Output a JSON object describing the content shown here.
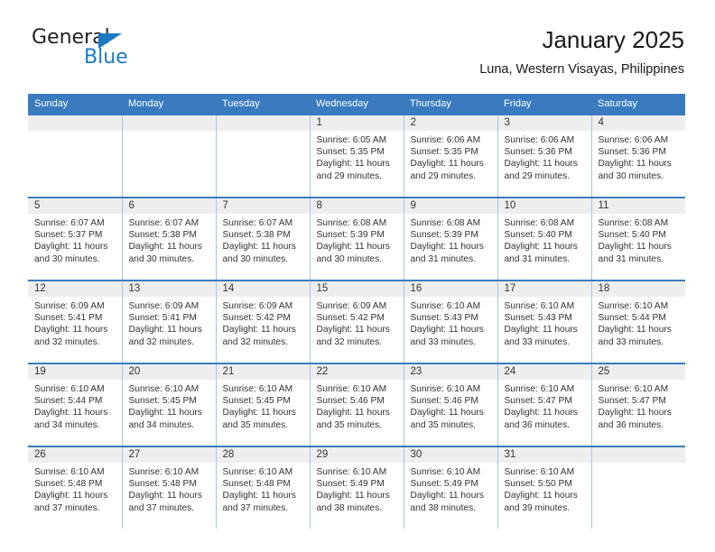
{
  "logo": {
    "word_top": "General",
    "word_bottom": "Blue",
    "triangle_name": "blue-triangle-icon",
    "colors": {
      "blue": "#1b7ac4",
      "dark": "#231f20"
    }
  },
  "header": {
    "title": "January 2025",
    "subtitle": "Luna, Western Visayas, Philippines"
  },
  "theme": {
    "header_blue": "#3a7bbf",
    "daynum_gray": "#eeeeee",
    "divider_blue": "#a8c4e0",
    "text": "#333333"
  },
  "calendar": {
    "weekday_headers": [
      "Sunday",
      "Monday",
      "Tuesday",
      "Wednesday",
      "Thursday",
      "Friday",
      "Saturday"
    ],
    "weeks": [
      [
        {
          "day": "",
          "lines": []
        },
        {
          "day": "",
          "lines": []
        },
        {
          "day": "",
          "lines": []
        },
        {
          "day": "1",
          "lines": [
            "Sunrise: 6:05 AM",
            "Sunset: 5:35 PM",
            "Daylight: 11 hours",
            "and 29 minutes."
          ]
        },
        {
          "day": "2",
          "lines": [
            "Sunrise: 6:06 AM",
            "Sunset: 5:35 PM",
            "Daylight: 11 hours",
            "and 29 minutes."
          ]
        },
        {
          "day": "3",
          "lines": [
            "Sunrise: 6:06 AM",
            "Sunset: 5:36 PM",
            "Daylight: 11 hours",
            "and 29 minutes."
          ]
        },
        {
          "day": "4",
          "lines": [
            "Sunrise: 6:06 AM",
            "Sunset: 5:36 PM",
            "Daylight: 11 hours",
            "and 30 minutes."
          ]
        }
      ],
      [
        {
          "day": "5",
          "lines": [
            "Sunrise: 6:07 AM",
            "Sunset: 5:37 PM",
            "Daylight: 11 hours",
            "and 30 minutes."
          ]
        },
        {
          "day": "6",
          "lines": [
            "Sunrise: 6:07 AM",
            "Sunset: 5:38 PM",
            "Daylight: 11 hours",
            "and 30 minutes."
          ]
        },
        {
          "day": "7",
          "lines": [
            "Sunrise: 6:07 AM",
            "Sunset: 5:38 PM",
            "Daylight: 11 hours",
            "and 30 minutes."
          ]
        },
        {
          "day": "8",
          "lines": [
            "Sunrise: 6:08 AM",
            "Sunset: 5:39 PM",
            "Daylight: 11 hours",
            "and 30 minutes."
          ]
        },
        {
          "day": "9",
          "lines": [
            "Sunrise: 6:08 AM",
            "Sunset: 5:39 PM",
            "Daylight: 11 hours",
            "and 31 minutes."
          ]
        },
        {
          "day": "10",
          "lines": [
            "Sunrise: 6:08 AM",
            "Sunset: 5:40 PM",
            "Daylight: 11 hours",
            "and 31 minutes."
          ]
        },
        {
          "day": "11",
          "lines": [
            "Sunrise: 6:08 AM",
            "Sunset: 5:40 PM",
            "Daylight: 11 hours",
            "and 31 minutes."
          ]
        }
      ],
      [
        {
          "day": "12",
          "lines": [
            "Sunrise: 6:09 AM",
            "Sunset: 5:41 PM",
            "Daylight: 11 hours",
            "and 32 minutes."
          ]
        },
        {
          "day": "13",
          "lines": [
            "Sunrise: 6:09 AM",
            "Sunset: 5:41 PM",
            "Daylight: 11 hours",
            "and 32 minutes."
          ]
        },
        {
          "day": "14",
          "lines": [
            "Sunrise: 6:09 AM",
            "Sunset: 5:42 PM",
            "Daylight: 11 hours",
            "and 32 minutes."
          ]
        },
        {
          "day": "15",
          "lines": [
            "Sunrise: 6:09 AM",
            "Sunset: 5:42 PM",
            "Daylight: 11 hours",
            "and 32 minutes."
          ]
        },
        {
          "day": "16",
          "lines": [
            "Sunrise: 6:10 AM",
            "Sunset: 5:43 PM",
            "Daylight: 11 hours",
            "and 33 minutes."
          ]
        },
        {
          "day": "17",
          "lines": [
            "Sunrise: 6:10 AM",
            "Sunset: 5:43 PM",
            "Daylight: 11 hours",
            "and 33 minutes."
          ]
        },
        {
          "day": "18",
          "lines": [
            "Sunrise: 6:10 AM",
            "Sunset: 5:44 PM",
            "Daylight: 11 hours",
            "and 33 minutes."
          ]
        }
      ],
      [
        {
          "day": "19",
          "lines": [
            "Sunrise: 6:10 AM",
            "Sunset: 5:44 PM",
            "Daylight: 11 hours",
            "and 34 minutes."
          ]
        },
        {
          "day": "20",
          "lines": [
            "Sunrise: 6:10 AM",
            "Sunset: 5:45 PM",
            "Daylight: 11 hours",
            "and 34 minutes."
          ]
        },
        {
          "day": "21",
          "lines": [
            "Sunrise: 6:10 AM",
            "Sunset: 5:45 PM",
            "Daylight: 11 hours",
            "and 35 minutes."
          ]
        },
        {
          "day": "22",
          "lines": [
            "Sunrise: 6:10 AM",
            "Sunset: 5:46 PM",
            "Daylight: 11 hours",
            "and 35 minutes."
          ]
        },
        {
          "day": "23",
          "lines": [
            "Sunrise: 6:10 AM",
            "Sunset: 5:46 PM",
            "Daylight: 11 hours",
            "and 35 minutes."
          ]
        },
        {
          "day": "24",
          "lines": [
            "Sunrise: 6:10 AM",
            "Sunset: 5:47 PM",
            "Daylight: 11 hours",
            "and 36 minutes."
          ]
        },
        {
          "day": "25",
          "lines": [
            "Sunrise: 6:10 AM",
            "Sunset: 5:47 PM",
            "Daylight: 11 hours",
            "and 36 minutes."
          ]
        }
      ],
      [
        {
          "day": "26",
          "lines": [
            "Sunrise: 6:10 AM",
            "Sunset: 5:48 PM",
            "Daylight: 11 hours",
            "and 37 minutes."
          ]
        },
        {
          "day": "27",
          "lines": [
            "Sunrise: 6:10 AM",
            "Sunset: 5:48 PM",
            "Daylight: 11 hours",
            "and 37 minutes."
          ]
        },
        {
          "day": "28",
          "lines": [
            "Sunrise: 6:10 AM",
            "Sunset: 5:48 PM",
            "Daylight: 11 hours",
            "and 37 minutes."
          ]
        },
        {
          "day": "29",
          "lines": [
            "Sunrise: 6:10 AM",
            "Sunset: 5:49 PM",
            "Daylight: 11 hours",
            "and 38 minutes."
          ]
        },
        {
          "day": "30",
          "lines": [
            "Sunrise: 6:10 AM",
            "Sunset: 5:49 PM",
            "Daylight: 11 hours",
            "and 38 minutes."
          ]
        },
        {
          "day": "31",
          "lines": [
            "Sunrise: 6:10 AM",
            "Sunset: 5:50 PM",
            "Daylight: 11 hours",
            "and 39 minutes."
          ]
        },
        {
          "day": "",
          "lines": []
        }
      ]
    ]
  }
}
